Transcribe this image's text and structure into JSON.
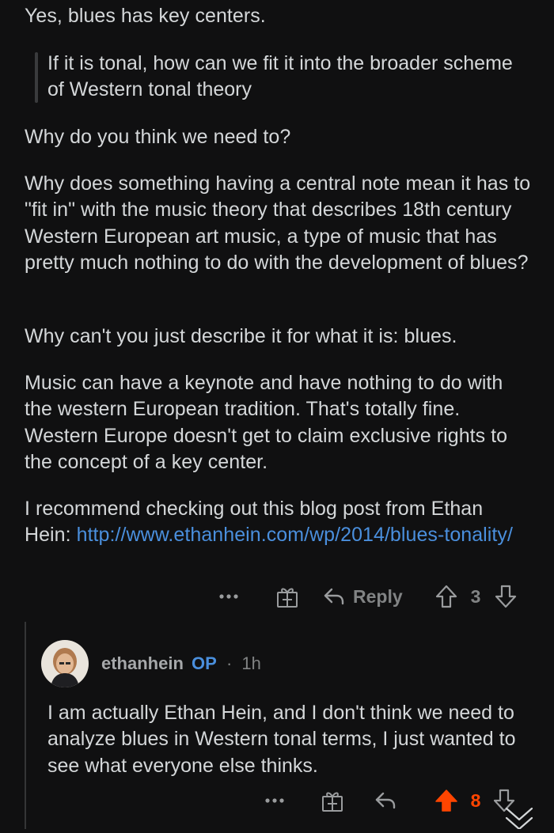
{
  "comment": {
    "paragraphs": [
      "Yes, blues has key centers.",
      "Why do you think we need to?",
      "Why does something having a central note mean it has to \"fit in\" with the music theory that describes 18th century Western European art music, a type of music that has pretty much nothing to do with the development of blues?",
      "Why can't you just describe it for what it is: blues.",
      "Music can have a keynote and have nothing to do with the western European tradition. That's totally fine. Western Europe doesn't get to claim exclusive rights to the concept of a key center."
    ],
    "quote": "If it is tonal, how can we fit it into the broader scheme of Western tonal theory",
    "last_paragraph_text": "I recommend checking out this blog post from Ethan Hein: ",
    "link_text": "http://www.ethanhein.com/wp/2014/blues-tonality/",
    "actions": {
      "more": "more-options",
      "award": "award",
      "reply_label": "Reply",
      "score": "3"
    }
  },
  "reply": {
    "username": "ethanhein",
    "op_tag": "OP",
    "separator": "·",
    "time": "1h",
    "text": "I am actually Ethan Hein, and I don't think we need to analyze blues in Western tonal terms, I just wanted to see what everyone else thinks.",
    "actions": {
      "score": "8",
      "upvoted": true
    }
  },
  "colors": {
    "background": "#101011",
    "text": "#d4d7d9",
    "muted": "#818384",
    "link": "#4a8fdd",
    "upvote": "#ff4500"
  }
}
